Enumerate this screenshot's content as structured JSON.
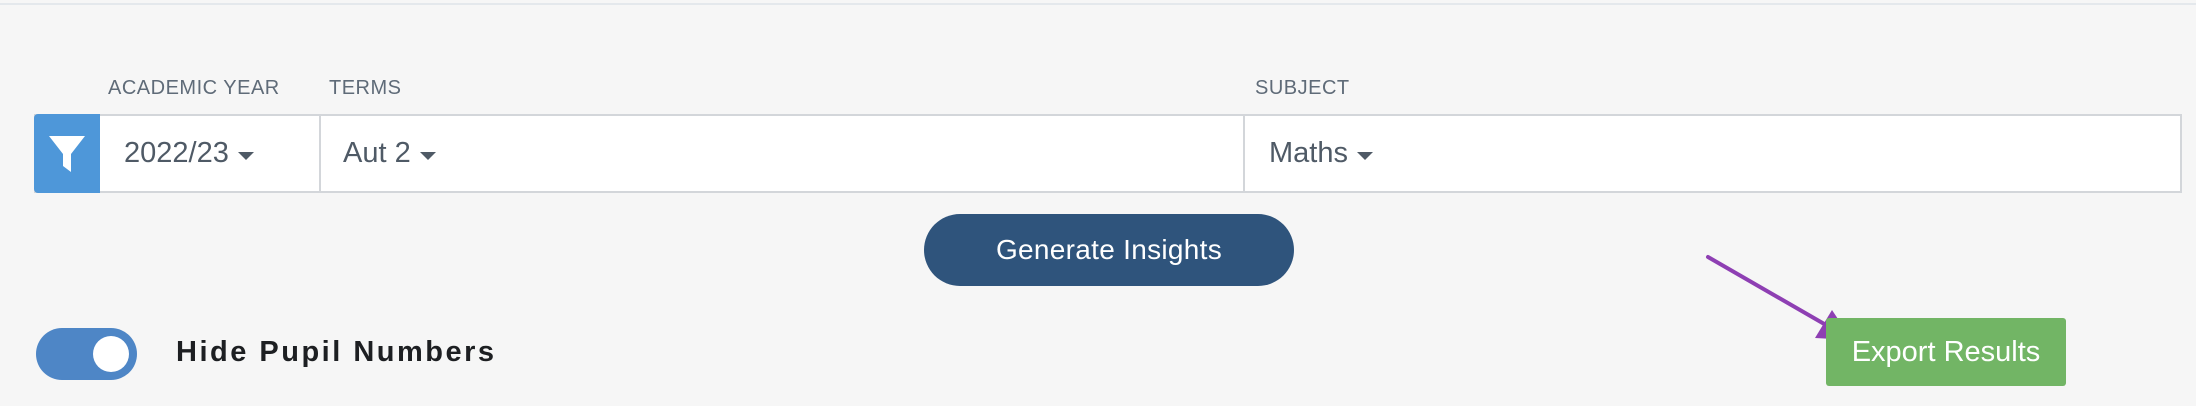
{
  "filters": {
    "academic_year_label": "ACADEMIC YEAR",
    "terms_label": "TERMS",
    "subject_label": "SUBJECT",
    "academic_year_value": "2022/23",
    "terms_value": "Aut 2",
    "subject_value": "Maths"
  },
  "actions": {
    "generate_label": "Generate Insights",
    "export_label": "Export Results"
  },
  "toggle": {
    "label": "Hide Pupil Numbers",
    "state": "on"
  },
  "colors": {
    "filter_button": "#4e97d9",
    "generate_button": "#2f547c",
    "export_button": "#72b565",
    "toggle": "#4e86c6",
    "annotation_arrow": "#8e3fb3"
  },
  "icons": {
    "filter": "filter-funnel-icon",
    "caret": "caret-down-icon",
    "annotation": "annotation-arrow-icon"
  }
}
